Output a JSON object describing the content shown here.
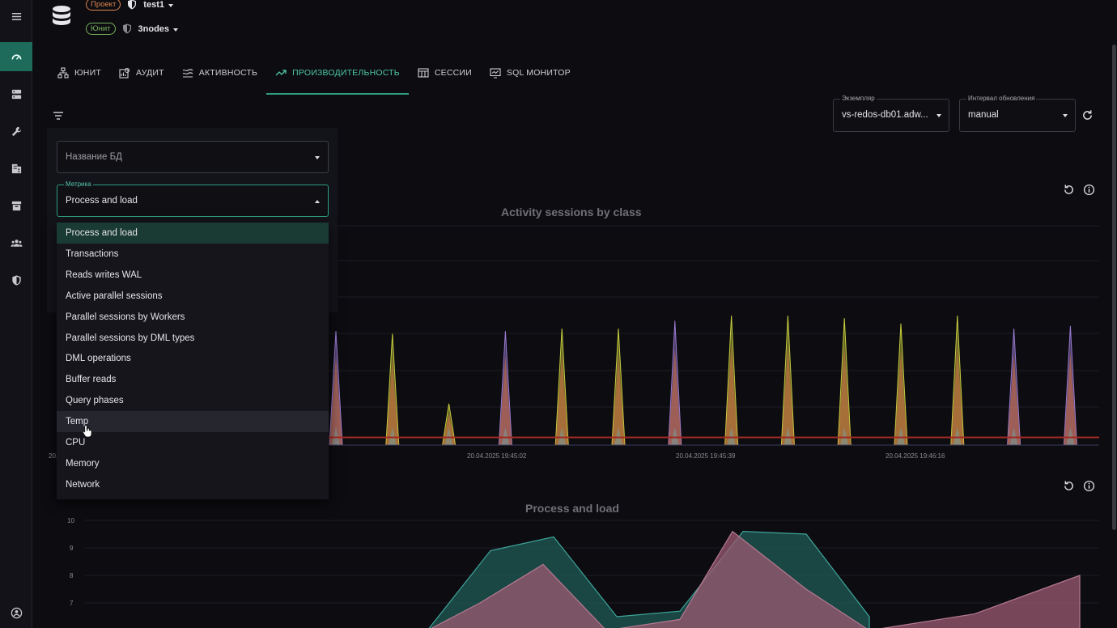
{
  "header": {
    "project_badge": "Проект",
    "project_name": "test1",
    "unit_badge": "Юнит",
    "unit_name": "3nodes"
  },
  "tabs": [
    {
      "label": "ЮНИТ",
      "icon": "sitemap-icon"
    },
    {
      "label": "АУДИТ",
      "icon": "audit-icon"
    },
    {
      "label": "АКТИВНОСТЬ",
      "icon": "waves-icon"
    },
    {
      "label": "ПРОИЗВОДИТЕЛЬНОСТЬ",
      "icon": "trend-icon",
      "active": true
    },
    {
      "label": "СЕССИИ",
      "icon": "table-icon"
    },
    {
      "label": "SQL МОНИТОР",
      "icon": "monitor-icon"
    }
  ],
  "instance_select": {
    "label": "Экземпляр",
    "value": "vs-redos-db01.adw..."
  },
  "interval_select": {
    "label": "Интервал обновления",
    "value": "manual"
  },
  "filters": {
    "db_name_placeholder": "Название БД",
    "metric_label": "Метрика",
    "metric_value": "Process and load"
  },
  "metric_options": [
    "Process and load",
    "Transactions",
    "Reads writes WAL",
    "Active parallel sessions",
    "Parallel sessions by Workers",
    "Parallel sessions by DML types",
    "DML operations",
    "Buffer reads",
    "Query phases",
    "Temp",
    "CPU",
    "Memory",
    "Network"
  ],
  "selected_option_index": 0,
  "hovered_option_index": 9,
  "sidebar_icons": [
    "menu-icon",
    "dashboard-icon",
    "server-icon",
    "wrench-icon",
    "building-icon",
    "archive-icon",
    "users-icon",
    "shield-icon",
    "account-icon"
  ],
  "colors": {
    "accent": "#2f9d80",
    "accent_text": "#4fc7a6",
    "active_rail": "#1f6b5b",
    "series_yellow": "#c6cc3c",
    "series_orange": "#e07a4a",
    "series_purple": "#9a7ad0",
    "series_teal": "#1f5a56",
    "series_pink": "#9c5a72",
    "threshold_red": "#a02a22"
  },
  "chart_data": [
    {
      "type": "area",
      "title": "Activity sessions by class",
      "x_tick_labels": [
        "20.",
        "20.04.2025 19:45:02",
        "20.04.2025 19:45:39",
        "20.04.2025 19:46:16"
      ],
      "spikes": [
        {
          "color": "purple",
          "peak": 0.88
        },
        {
          "color": "yellow",
          "peak": 0.86
        },
        {
          "color": "yellow",
          "peak": 0.32
        },
        {
          "color": "purple",
          "peak": 0.88
        },
        {
          "color": "yellow",
          "peak": 0.9
        },
        {
          "color": "yellow",
          "peak": 0.9
        },
        {
          "color": "purple",
          "peak": 0.96
        },
        {
          "color": "yellow",
          "peak": 1.0
        },
        {
          "color": "yellow",
          "peak": 1.0
        },
        {
          "color": "yellow",
          "peak": 0.98
        },
        {
          "color": "yellow",
          "peak": 0.94
        },
        {
          "color": "yellow",
          "peak": 1.0
        },
        {
          "color": "purple",
          "peak": 0.9
        },
        {
          "color": "purple",
          "peak": 0.92
        }
      ],
      "threshold_level": 0.06
    },
    {
      "type": "area",
      "title": "Process and load",
      "y_ticks": [
        10,
        9,
        8,
        7
      ],
      "series": [
        {
          "color": "teal",
          "points": [
            [
              0.36,
              6
            ],
            [
              0.42,
              8.9
            ],
            [
              0.48,
              9.4
            ],
            [
              0.54,
              6.5
            ],
            [
              0.6,
              6.7
            ],
            [
              0.66,
              9.6
            ],
            [
              0.72,
              9.5
            ],
            [
              0.78,
              6.5
            ]
          ]
        },
        {
          "color": "pink",
          "points": [
            [
              0.36,
              6
            ],
            [
              0.41,
              7
            ],
            [
              0.47,
              8.4
            ],
            [
              0.53,
              6
            ],
            [
              0.6,
              6.4
            ],
            [
              0.65,
              9.6
            ],
            [
              0.72,
              7.5
            ],
            [
              0.78,
              6
            ],
            [
              0.88,
              6.6
            ],
            [
              0.98,
              8
            ]
          ]
        }
      ],
      "ylim": [
        6,
        10
      ]
    }
  ]
}
